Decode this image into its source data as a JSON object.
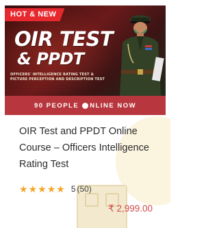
{
  "banner": {
    "badge": "HOT & NEW",
    "title_line1": "OIR TEST",
    "title_line2": "& PPDT",
    "subtitle_line1": "OFFICERS' INTELLIGENCE RATING TEST &",
    "subtitle_line2": "PICTURE PERCEPTION AND DESCRIPTION TEST"
  },
  "online": {
    "prefix": "90 PEOPLE",
    "suffix": "NLINE NOW"
  },
  "course": {
    "title": "OIR Test and PPDT Online Course – Officers Intelligence Rating Test",
    "rating_value": "5",
    "rating_count": "(50)",
    "stars": 5,
    "price": "₹ 2,999.00"
  },
  "colors": {
    "badge": "#e8282f",
    "online_strip": "#b8373e",
    "star": "#f5a524",
    "price": "#d24b4b"
  }
}
